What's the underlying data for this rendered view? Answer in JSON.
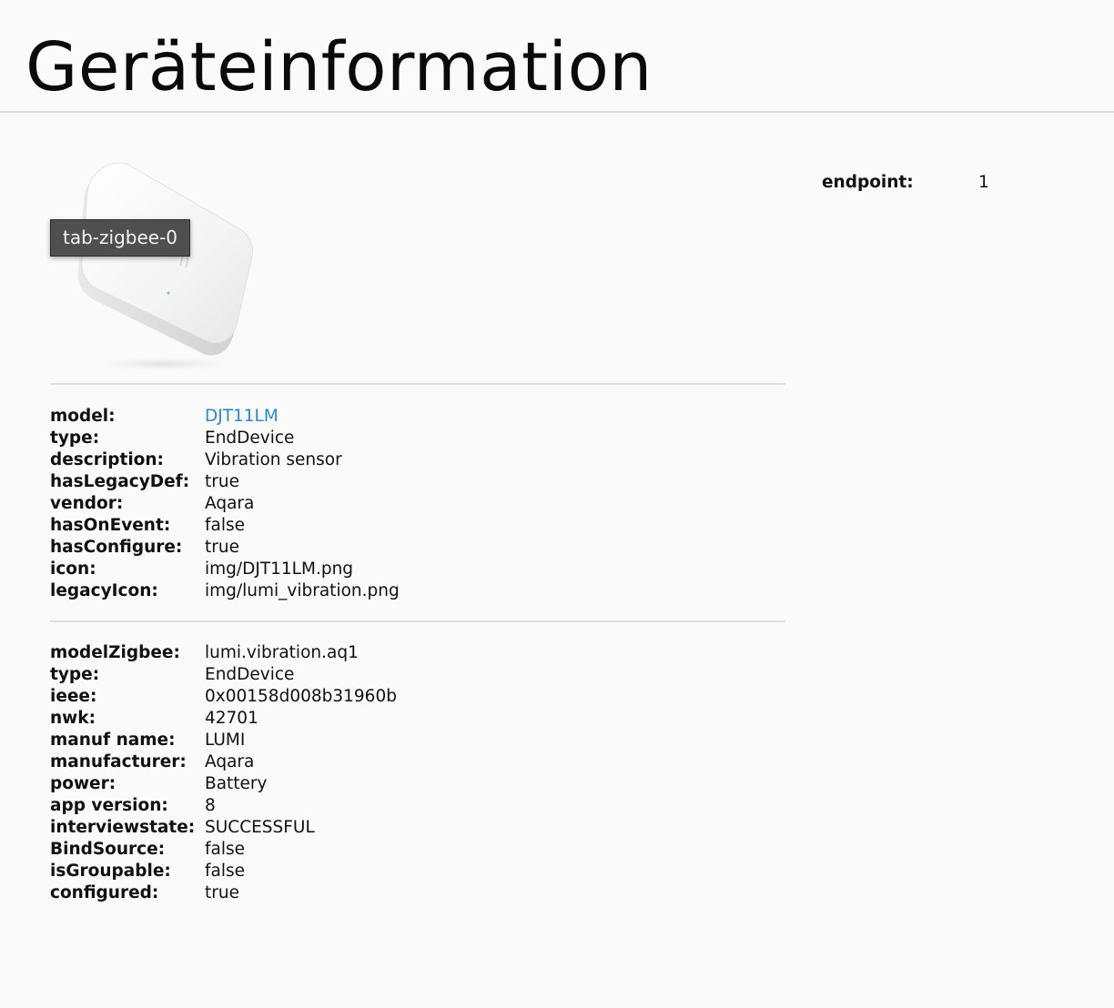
{
  "header": {
    "title": "Geräteinformation"
  },
  "device": {
    "image_alt": "Aqara vibration sensor",
    "tooltip": "tab-zigbee-0"
  },
  "endpoint": {
    "label": "endpoint:",
    "value": "1"
  },
  "definition": {
    "rows": [
      {
        "key": "model:",
        "value": "DJT11LM",
        "link": true
      },
      {
        "key": "type:",
        "value": "EndDevice"
      },
      {
        "key": "description:",
        "value": "Vibration sensor"
      },
      {
        "key": "hasLegacyDef:",
        "value": "true"
      },
      {
        "key": "vendor:",
        "value": "Aqara"
      },
      {
        "key": "hasOnEvent:",
        "value": "false"
      },
      {
        "key": "hasConfigure:",
        "value": "true"
      },
      {
        "key": "icon:",
        "value": "img/DJT11LM.png"
      },
      {
        "key": "legacyIcon:",
        "value": "img/lumi_vibration.png"
      }
    ]
  },
  "zigbee": {
    "rows": [
      {
        "key": "modelZigbee:",
        "value": "lumi.vibration.aq1"
      },
      {
        "key": "type:",
        "value": "EndDevice"
      },
      {
        "key": "ieee:",
        "value": "0x00158d008b31960b"
      },
      {
        "key": "nwk:",
        "value": "42701"
      },
      {
        "key": "manuf name:",
        "value": "LUMI"
      },
      {
        "key": "manufacturer:",
        "value": "Aqara"
      },
      {
        "key": "power:",
        "value": "Battery"
      },
      {
        "key": "app version:",
        "value": "8"
      },
      {
        "key": "interviewstate:",
        "value": "SUCCESSFUL"
      },
      {
        "key": "BindSource:",
        "value": "false"
      },
      {
        "key": "isGroupable:",
        "value": "false"
      },
      {
        "key": "configured:",
        "value": "true"
      }
    ]
  }
}
